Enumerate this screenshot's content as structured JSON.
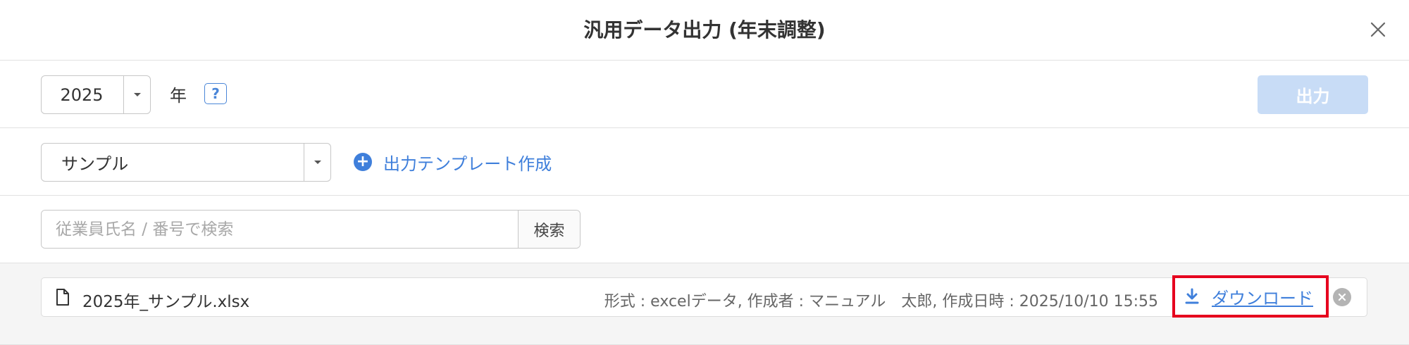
{
  "dialog": {
    "title": "汎用データ出力 (年末調整)",
    "close_icon": "close-icon"
  },
  "year": {
    "value": "2025",
    "unit_label": "年",
    "help_label": "?"
  },
  "output_button": {
    "label": "出力",
    "state": "disabled"
  },
  "template": {
    "selected": "サンプル",
    "add_label": "出力テンプレート作成"
  },
  "search": {
    "placeholder": "従業員氏名 / 番号で検索",
    "value": "",
    "button_label": "検索"
  },
  "files": [
    {
      "name": "2025年_サンプル.xlsx",
      "meta": "形式 : excelデータ, 作成者 : マニュアル　太郎, 作成日時 : 2025/10/10 15:55",
      "download_label": "ダウンロード"
    }
  ],
  "colors": {
    "accent": "#3f7fdb",
    "output_disabled": "#c8dcf6",
    "highlight_border": "#e6001e",
    "footer_background": "#f5f5f5"
  }
}
